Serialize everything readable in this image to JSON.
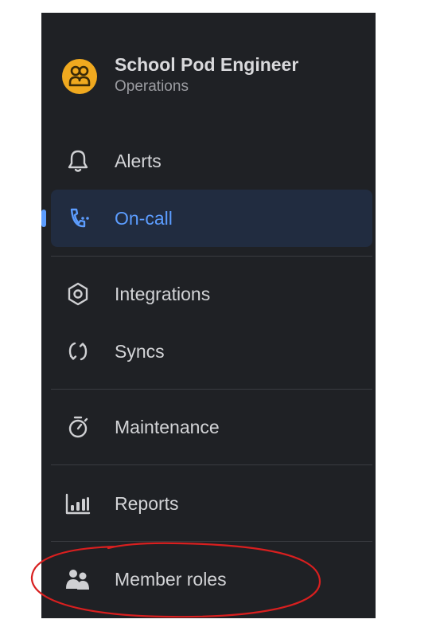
{
  "workspace": {
    "name": "School Pod Engineer",
    "subtitle": "Operations",
    "avatar_icon": "users-face-icon",
    "avatar_color": "#f0a91f"
  },
  "nav": {
    "active_color": "#5c9dff",
    "items": [
      {
        "label": "Alerts",
        "icon": "bell-icon",
        "active": false
      },
      {
        "label": "On-call",
        "icon": "phone-call-icon",
        "active": true
      },
      {
        "label": "Integrations",
        "icon": "hexagon-icon",
        "active": false
      },
      {
        "label": "Syncs",
        "icon": "sync-icon",
        "active": false
      },
      {
        "label": "Maintenance",
        "icon": "stopwatch-icon",
        "active": false
      },
      {
        "label": "Reports",
        "icon": "bar-chart-icon",
        "active": false
      },
      {
        "label": "Member roles",
        "icon": "people-icon",
        "active": false
      }
    ]
  },
  "annotation": {
    "shape": "freehand-circle",
    "target": "Member roles",
    "color": "#d81f1f"
  }
}
